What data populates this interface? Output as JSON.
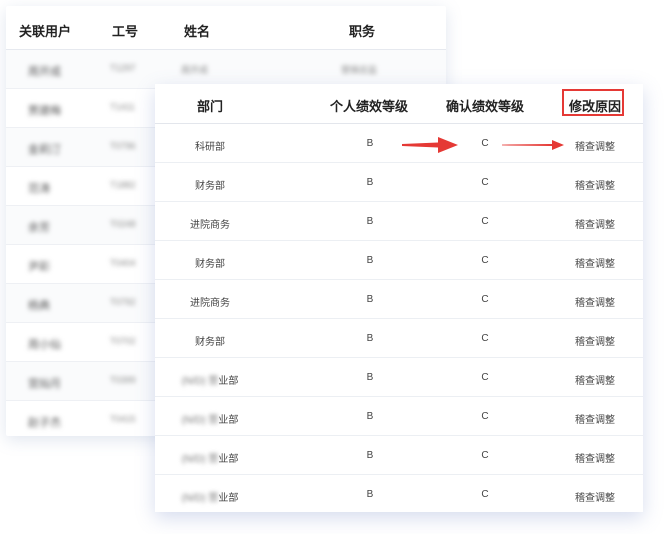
{
  "back_table": {
    "headers": [
      "关联用户",
      "工号",
      "姓名",
      "职务"
    ],
    "rows": [
      {
        "user": "周开成",
        "id": "T1297",
        "name": "周开成",
        "title": "营销总监"
      },
      {
        "user": "贾建梅",
        "id": "T1411",
        "name": "",
        "title": ""
      },
      {
        "user": "金莉汀",
        "id": "T0796",
        "name": "",
        "title": ""
      },
      {
        "user": "范涛",
        "id": "T1882",
        "name": "",
        "title": ""
      },
      {
        "user": "余芳",
        "id": "T0248",
        "name": "",
        "title": ""
      },
      {
        "user": "尹彩",
        "id": "T0404",
        "name": "",
        "title": ""
      },
      {
        "user": "杨典",
        "id": "T0792",
        "name": "",
        "title": ""
      },
      {
        "user": "周小仙",
        "id": "T0702",
        "name": "",
        "title": ""
      },
      {
        "user": "宫灿月",
        "id": "T0399",
        "name": "",
        "title": ""
      },
      {
        "user": "赵子杰",
        "id": "T0415",
        "name": "",
        "title": ""
      }
    ]
  },
  "front_table": {
    "headers": {
      "dept": "部门",
      "personal_grade": "个人绩效等级",
      "confirmed_grade": "确认绩效等级",
      "reason": "修改原因"
    },
    "rows": [
      {
        "dept": "科研部",
        "dept_blur": false,
        "personal": "B",
        "confirmed": "C",
        "reason": "稽查调整"
      },
      {
        "dept": "财务部",
        "dept_blur": false,
        "personal": "B",
        "confirmed": "C",
        "reason": "稽查调整"
      },
      {
        "dept": "进院商务",
        "dept_blur": false,
        "personal": "B",
        "confirmed": "C",
        "reason": "稽查调整"
      },
      {
        "dept": "财务部",
        "dept_blur": false,
        "personal": "B",
        "confirmed": "C",
        "reason": "稽查调整"
      },
      {
        "dept": "进院商务",
        "dept_blur": false,
        "personal": "B",
        "confirmed": "C",
        "reason": "稽查调整"
      },
      {
        "dept": "财务部",
        "dept_blur": false,
        "personal": "B",
        "confirmed": "C",
        "reason": "稽查调整"
      },
      {
        "dept_prefix": "(N/D) 营",
        "dept": "业部",
        "dept_blur": true,
        "personal": "B",
        "confirmed": "C",
        "reason": "稽查调整"
      },
      {
        "dept_prefix": "(N/D) 营",
        "dept": "业部",
        "dept_blur": true,
        "personal": "B",
        "confirmed": "C",
        "reason": "稽查调整"
      },
      {
        "dept_prefix": "(N/D) 营",
        "dept": "业部",
        "dept_blur": true,
        "personal": "B",
        "confirmed": "C",
        "reason": "稽查调整"
      },
      {
        "dept_prefix": "(N/D) 营",
        "dept": "业部",
        "dept_blur": true,
        "personal": "B",
        "confirmed": "C",
        "reason": "稽查调整"
      }
    ]
  },
  "annotations": {
    "highlight_color": "#e53935",
    "arrow_color": "#e53935"
  }
}
